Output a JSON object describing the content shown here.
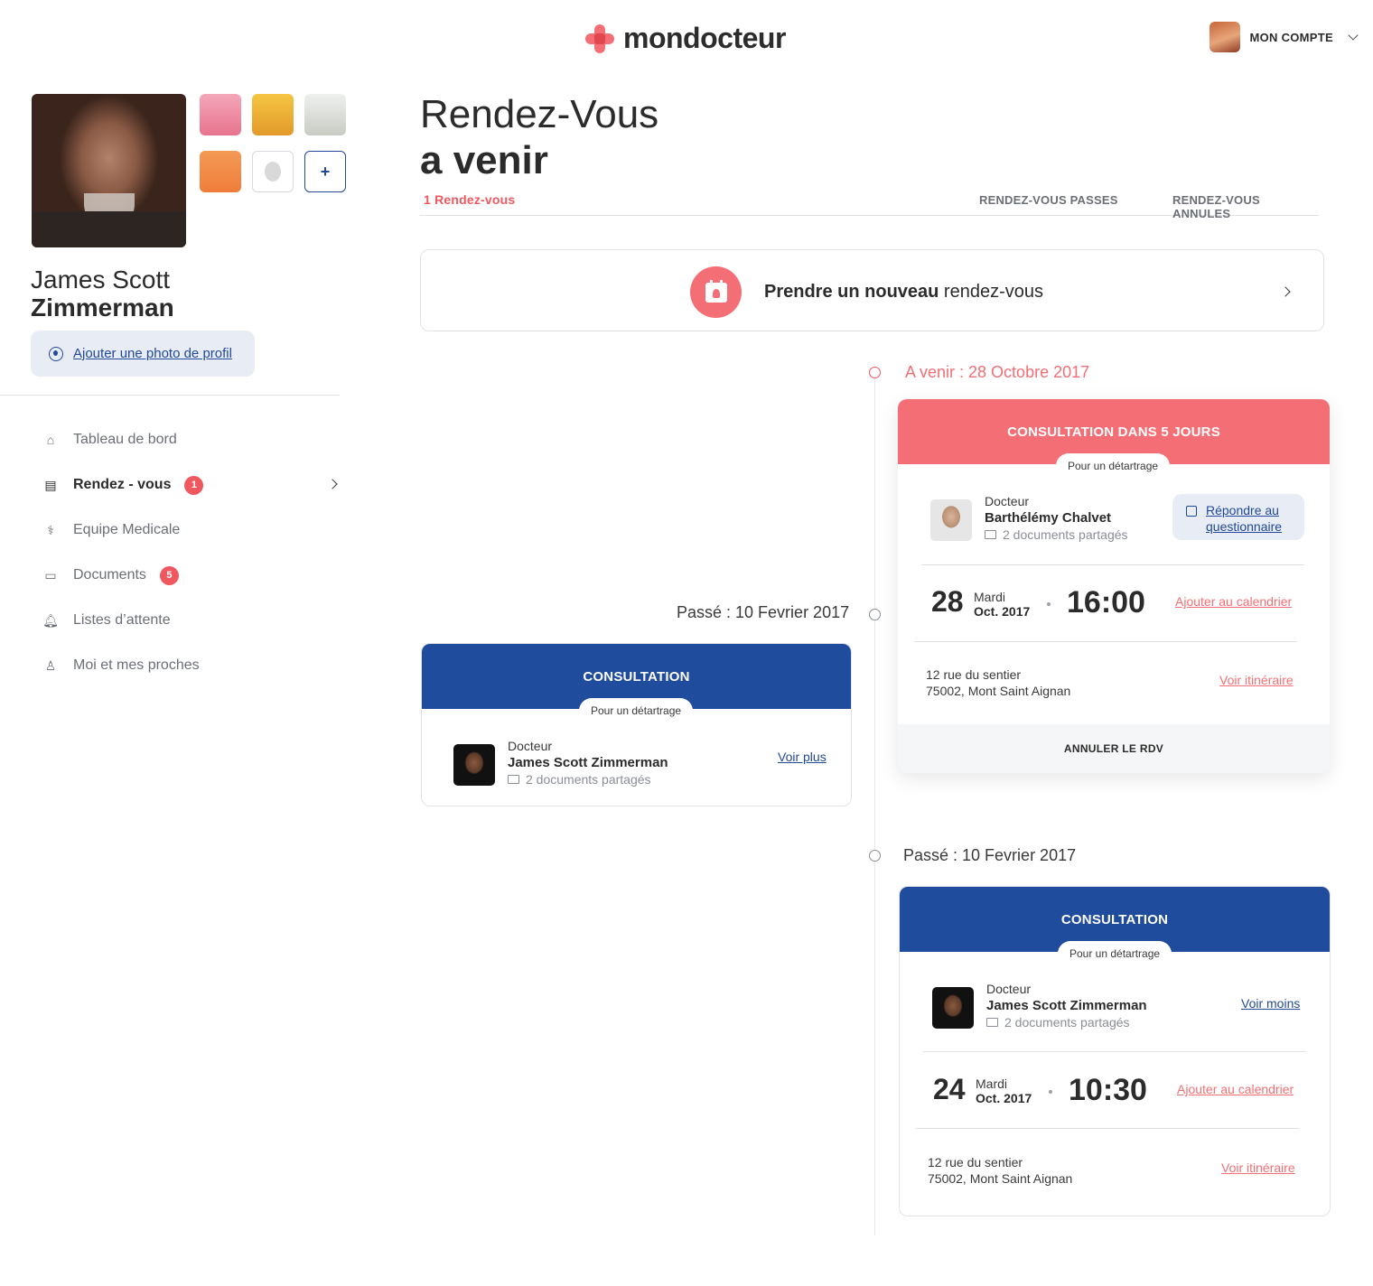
{
  "header": {
    "logo_text": "mondocteur",
    "account_label": "MON COMPTE"
  },
  "profile": {
    "first_name": "James Scott",
    "last_name": "Zimmerman",
    "add_photo_label": "Ajouter une photo de profil",
    "add_member_label": "+"
  },
  "nav": {
    "items": [
      {
        "label": "Tableau de bord",
        "icon": "home-icon"
      },
      {
        "label": "Rendez - vous",
        "icon": "calendar-icon",
        "badge": "1",
        "active": true
      },
      {
        "label": "Equipe Medicale",
        "icon": "stethoscope-icon"
      },
      {
        "label": "Documents",
        "icon": "folder-icon",
        "badge": "5"
      },
      {
        "label": "Listes d’attente",
        "icon": "bell-icon"
      },
      {
        "label": "Moi et mes proches",
        "icon": "user-icon"
      }
    ]
  },
  "page": {
    "title_line1": "Rendez-Vous",
    "title_line2": "a venir",
    "tabs": {
      "active": "1 Rendez-vous",
      "past": "RENDEZ-VOUS PASSES",
      "cancelled": "RENDEZ-VOUS ANNULES"
    },
    "new_rdv": {
      "bold": "Prendre un nouveau",
      "rest": " rendez-vous"
    }
  },
  "timeline": {
    "upcoming_label": "A venir : 28 Octobre 2017",
    "past_label_left": "Passé : 10 Fevrier 2017",
    "past_label_right": "Passé : 10 Fevrier 2017"
  },
  "cards": {
    "upcoming": {
      "header": "CONSULTATION DANS 5 JOURS",
      "reason": "Pour un détartrage",
      "doc_title": "Docteur",
      "doc_name": "Barthélémy Chalvet",
      "docs": "2 documents  partagés",
      "quest_line1": "Répondre au",
      "quest_line2": "questionnaire",
      "day_num": "28",
      "day_name": "Mardi",
      "month": "Oct. 2017",
      "time": "16:00",
      "calendar_link": "Ajouter au calendrier",
      "addr1": "12 rue du sentier",
      "addr2": "75002, Mont Saint Aignan",
      "itinerary_link": "Voir itinéraire",
      "cancel_label": "ANNULER LE RDV"
    },
    "past_left": {
      "header": "CONSULTATION",
      "reason": "Pour un détartrage",
      "doc_title": "Docteur",
      "doc_name": "James Scott Zimmerman",
      "docs": "2 documents  partagés",
      "more_link": "Voir plus"
    },
    "past_right": {
      "header": "CONSULTATION",
      "reason": "Pour un détartrage",
      "doc_title": "Docteur",
      "doc_name": "James Scott Zimmerman",
      "docs": "2 documents  partagés",
      "less_link": "Voir moins",
      "day_num": "24",
      "day_name": "Mardi",
      "month": "Oct. 2017",
      "time": "10:30",
      "calendar_link": "Ajouter au calendrier",
      "addr1": "12 rue du sentier",
      "addr2": "75002, Mont Saint Aignan",
      "itinerary_link": "Voir itinéraire"
    }
  },
  "colors": {
    "accent_red": "#f36f75",
    "brand_blue": "#1f4c9c",
    "link_blue": "#23499a"
  }
}
